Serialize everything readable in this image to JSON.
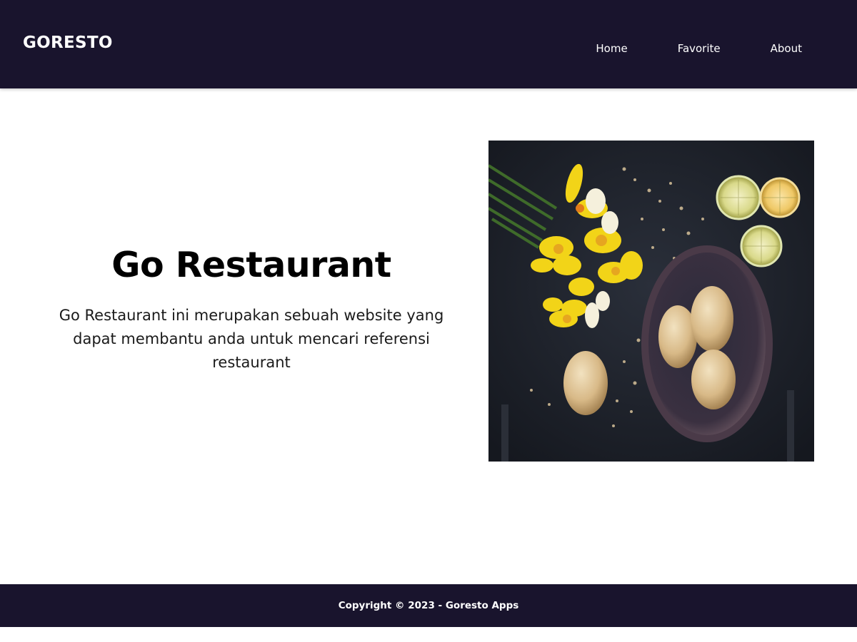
{
  "header": {
    "brand": "GORESTO",
    "nav": [
      {
        "label": "Home"
      },
      {
        "label": "Favorite"
      },
      {
        "label": "About"
      }
    ]
  },
  "hero": {
    "title": "Go Restaurant",
    "description": "Go Restaurant ini merupakan sebuah website yang dapat membantu anda untuk mencari referensi restaurant"
  },
  "footer": {
    "copyright": "Copyright © 2023 - Goresto Apps"
  },
  "colors": {
    "header_bg": "#19142d",
    "footer_bg": "#19142d",
    "page_bg": "#ffffff"
  }
}
